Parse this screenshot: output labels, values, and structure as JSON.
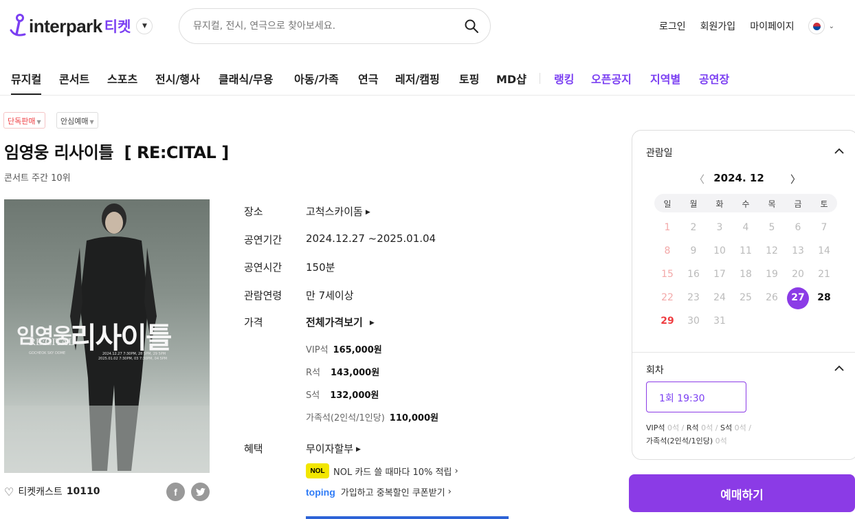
{
  "header": {
    "logo_text": "interpark",
    "logo_sub": "티켓",
    "search_placeholder": "뮤지컬, 전시, 연극으로 찾아보세요.",
    "links": [
      "로그인",
      "회원가입",
      "마이페이지"
    ]
  },
  "nav": {
    "items": [
      "뮤지컬",
      "콘서트",
      "스포츠",
      "전시/행사",
      "클래식/무용",
      "아동/가족",
      "연극",
      "레저/캠핑",
      "토핑",
      "MD샵"
    ],
    "extra": [
      "랭킹",
      "오픈공지",
      "지역별",
      "공연장"
    ]
  },
  "product": {
    "badges": [
      "단독판매",
      "안심예매"
    ],
    "title": "임영웅 리사이틀  [ RE:CITAL ]",
    "subtitle": "콘서트 주간 10위",
    "poster": {
      "name_ko": "임영웅",
      "recital_en": "RE:CITAL",
      "recital_ko": "리사이틀",
      "venue_en": "GOCHEOK SKY DOME",
      "dates1": "2024.12.27 7:30PM, 28 5PM, 29 5PM",
      "dates2": "2025.01.02 7:30PM, 03 7:30PM, 04 5PM"
    },
    "cast_label": "티켓캐스트",
    "cast_count": "10110"
  },
  "info": {
    "venue_label": "장소",
    "venue": "고척스카이돔",
    "period_label": "공연기간",
    "period": "2024.12.27 ~2025.01.04",
    "time_label": "공연시간",
    "time": "150분",
    "age_label": "관람연령",
    "age": "만 7세이상",
    "price_label": "가격",
    "price_all": "전체가격보기",
    "prices": [
      {
        "name": "VIP석",
        "value": "165,000원"
      },
      {
        "name": "R석",
        "value": "143,000원"
      },
      {
        "name": "S석",
        "value": "132,000원"
      },
      {
        "name": "가족석(2인석/1인당)",
        "value": "110,000원"
      }
    ],
    "benefit_label": "혜택",
    "benefit_main": "무이자할부",
    "benefit_nol": "NOL 카드 쓸 때마다 10% 적립",
    "nol_logo": "NOL",
    "benefit_toping": "가입하고 중복할인 쿠폰받기",
    "toping_logo": "toping"
  },
  "calendar": {
    "heading": "관람일",
    "month": "2024. 12",
    "weekdays": [
      "일",
      "월",
      "화",
      "수",
      "목",
      "금",
      "토"
    ],
    "days": [
      "1",
      "2",
      "3",
      "4",
      "5",
      "6",
      "7",
      "8",
      "9",
      "10",
      "11",
      "12",
      "13",
      "14",
      "15",
      "16",
      "17",
      "18",
      "19",
      "20",
      "21",
      "22",
      "23",
      "24",
      "25",
      "26",
      "27",
      "28",
      "29",
      "30",
      "31"
    ],
    "selected": "27",
    "available": [
      "28",
      "29"
    ]
  },
  "session": {
    "heading": "회차",
    "button": "1회 19:30",
    "seats": [
      {
        "name": "VIP석",
        "count": "0석"
      },
      {
        "name": "R석",
        "count": "0석"
      },
      {
        "name": "S석",
        "count": "0석"
      },
      {
        "name": "가족석(2인석/1인당)",
        "count": "0석"
      }
    ]
  },
  "book_button": "예매하기",
  "colors": {
    "accent": "#8b3be6",
    "red": "#ef3e42"
  }
}
